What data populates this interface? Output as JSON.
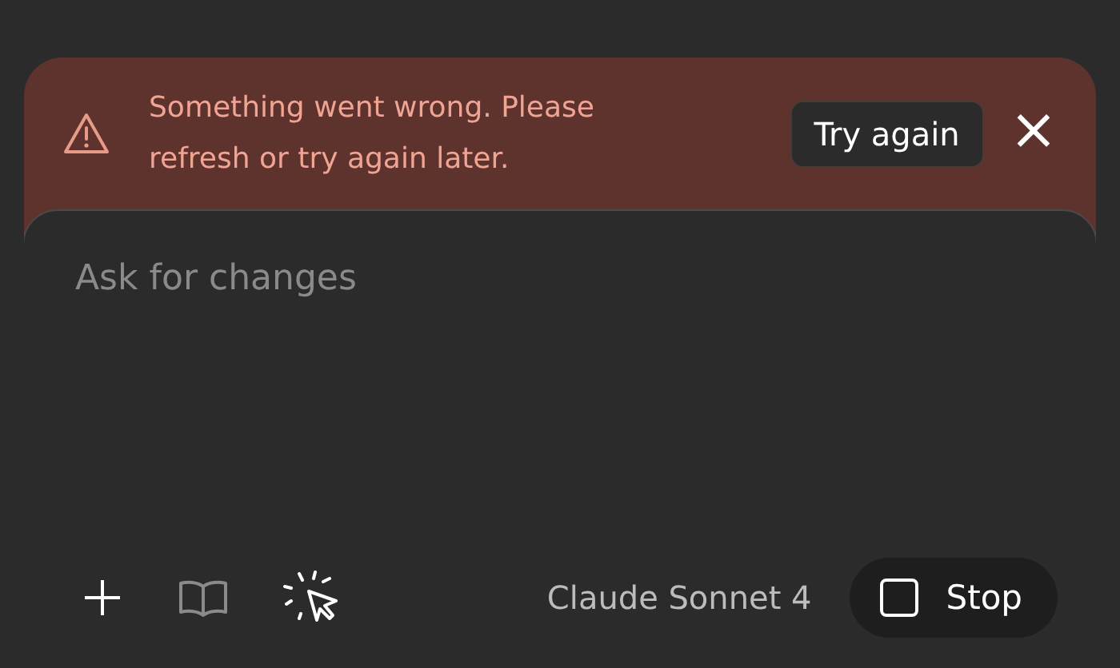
{
  "error_banner": {
    "message": "Something went wrong. Please refresh or try again later.",
    "retry_button": "Try again",
    "dismiss": "×"
  },
  "composer": {
    "placeholder": "Ask for changes",
    "tools": [
      {
        "kind": "add",
        "disabled": false
      },
      {
        "kind": "book",
        "disabled": true
      },
      {
        "kind": "pointer",
        "disabled": false
      }
    ],
    "model": "Claude Sonnet 4",
    "stop_button": "Stop"
  }
}
